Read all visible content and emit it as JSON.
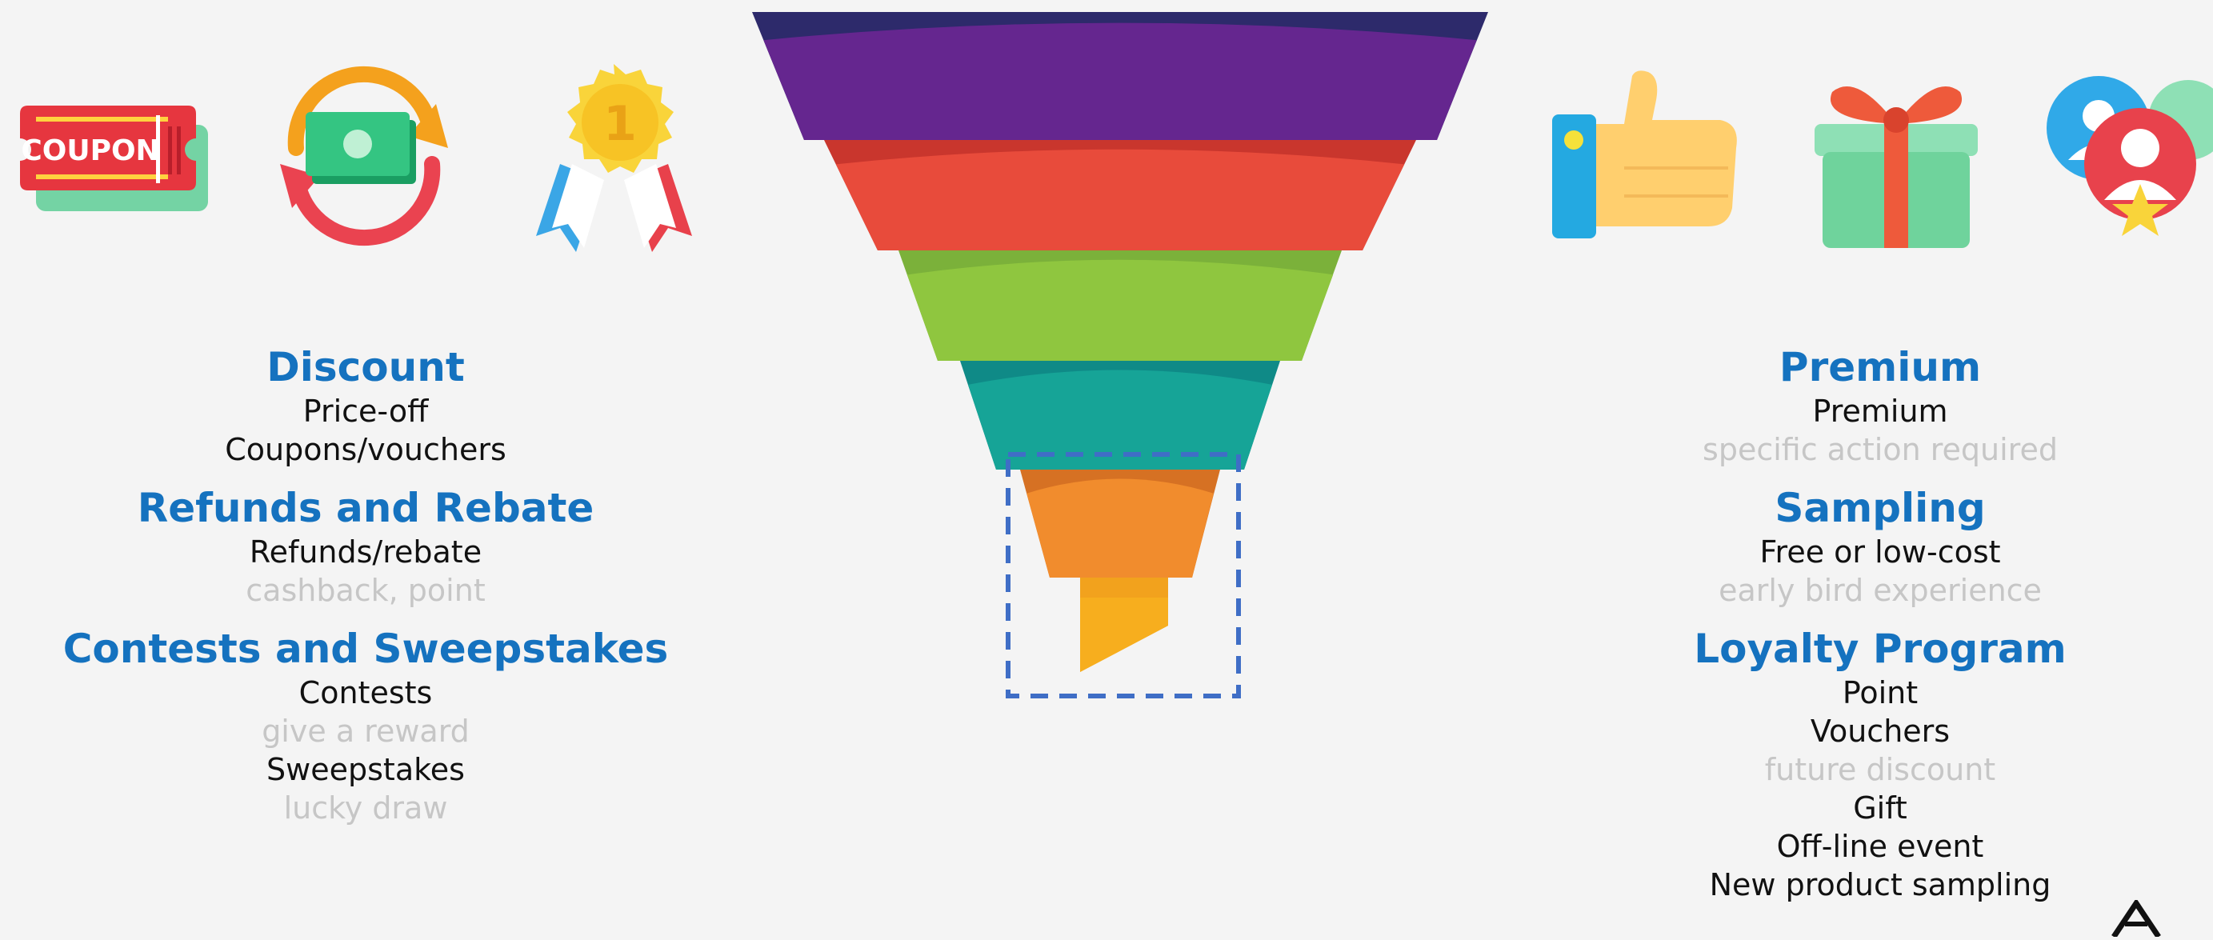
{
  "left_icons": [
    {
      "name": "coupon-icon",
      "label": "COUPON"
    },
    {
      "name": "money-exchange-icon"
    },
    {
      "name": "award-medal-icon",
      "label": "1"
    }
  ],
  "right_icons": [
    {
      "name": "thumbs-up-icon"
    },
    {
      "name": "gift-box-icon"
    },
    {
      "name": "loyalty-members-icon"
    }
  ],
  "funnel": {
    "layers": [
      {
        "color": "#65268f",
        "shade": "#2d2a6b"
      },
      {
        "color": "#e84b3b",
        "shade": "#c9362d"
      },
      {
        "color": "#8fc63f",
        "shade": "#7bb13a"
      },
      {
        "color": "#16a497",
        "shade": "#0f8a87"
      },
      {
        "color": "#f18c2d",
        "shade": "#d67123"
      },
      {
        "color": "#f7ae1e",
        "shade": "#f2a21d"
      }
    ],
    "highlight_color": "#3f6ec6"
  },
  "left": [
    {
      "heading": "Discount",
      "lines": [
        {
          "text": "Price-off",
          "style": "primary"
        },
        {
          "text": "Coupons/vouchers",
          "style": "primary"
        }
      ]
    },
    {
      "heading": "Refunds and Rebate",
      "lines": [
        {
          "text": "Refunds/rebate",
          "style": "primary"
        },
        {
          "text": "cashback, point",
          "style": "note"
        }
      ]
    },
    {
      "heading": "Contests and Sweepstakes",
      "lines": [
        {
          "text": "Contests",
          "style": "primary"
        },
        {
          "text": "give a reward",
          "style": "note"
        },
        {
          "text": "Sweepstakes",
          "style": "primary"
        },
        {
          "text": "lucky draw",
          "style": "note"
        }
      ]
    }
  ],
  "right": [
    {
      "heading": "Premium",
      "lines": [
        {
          "text": "Premium",
          "style": "primary"
        },
        {
          "text": "specific action required",
          "style": "note"
        }
      ]
    },
    {
      "heading": "Sampling",
      "lines": [
        {
          "text": "Free or low-cost",
          "style": "primary"
        },
        {
          "text": "early bird experience",
          "style": "note"
        }
      ]
    },
    {
      "heading": "Loyalty Program",
      "lines": [
        {
          "text": "Point",
          "style": "primary"
        },
        {
          "text": "Vouchers",
          "style": "primary"
        },
        {
          "text": "future discount",
          "style": "note"
        },
        {
          "text": "Gift",
          "style": "primary"
        },
        {
          "text": "Off-line event",
          "style": "primary"
        },
        {
          "text": "New product sampling",
          "style": "primary"
        }
      ]
    }
  ]
}
